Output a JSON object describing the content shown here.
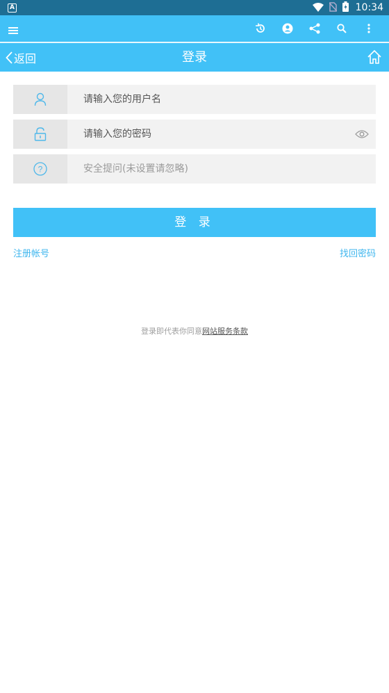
{
  "status": {
    "time": "10:34",
    "left_icon": "A"
  },
  "toolbar": {
    "icons": [
      "menu-icon",
      "history-icon",
      "account-icon",
      "share-icon",
      "search-icon",
      "more-vert-icon"
    ]
  },
  "nav": {
    "back_label": "返回",
    "title": "登录"
  },
  "form": {
    "username_placeholder": "请输入您的用户名",
    "password_placeholder": "请输入您的密码",
    "security_placeholder": "安全提问(未设置请忽略)"
  },
  "actions": {
    "login_label": "登 录",
    "register_label": "注册帐号",
    "recover_label": "找回密码"
  },
  "footer": {
    "prefix": "登录即代表你同意",
    "terms_link": "网站服务条款"
  },
  "colors": {
    "primary": "#41c1f7",
    "status_bar": "#1e6e94",
    "link": "#3fb6ee"
  }
}
